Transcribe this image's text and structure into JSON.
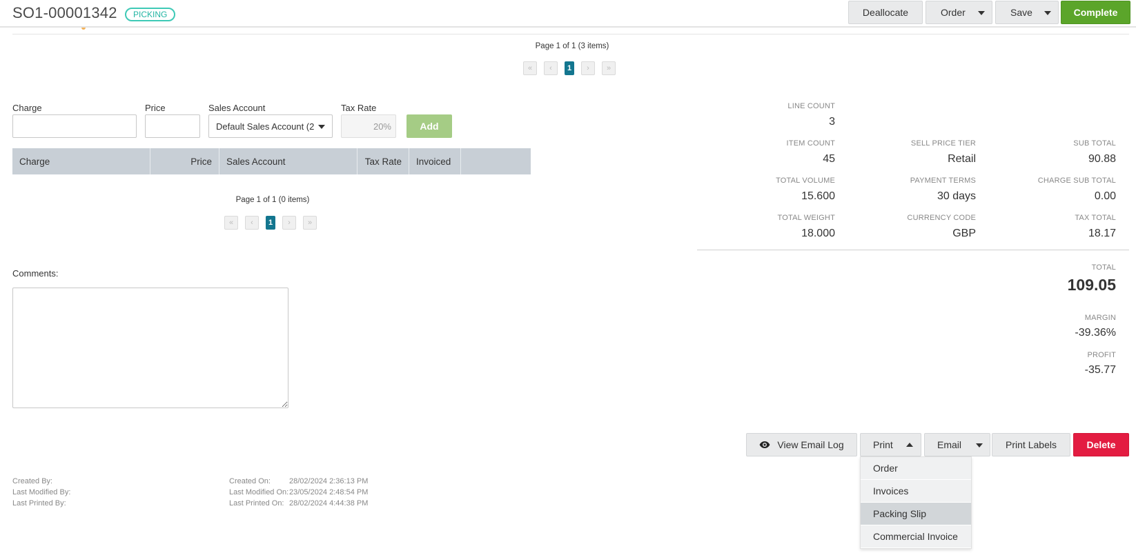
{
  "header": {
    "order_number": "SO1-00001342",
    "status": "PICKING",
    "buttons": {
      "deallocate": "Deallocate",
      "order": "Order",
      "save": "Save",
      "complete": "Complete"
    }
  },
  "lines_pager": {
    "text": "Page 1 of 1 (3 items)",
    "current": "1"
  },
  "charge_form": {
    "charge_label": "Charge",
    "charge_value": "",
    "price_label": "Price",
    "price_value": "",
    "sales_account_label": "Sales Account",
    "sales_account_selected": "Default Sales Account (2",
    "tax_rate_label": "Tax Rate",
    "tax_rate_value": "20%",
    "add_label": "Add"
  },
  "charges_table": {
    "columns": [
      "Charge",
      "Price",
      "Sales Account",
      "Tax Rate",
      "Invoiced",
      ""
    ],
    "rows": []
  },
  "charges_pager": {
    "text": "Page 1 of 1 (0 items)",
    "current": "1"
  },
  "comments": {
    "label": "Comments:",
    "value": ""
  },
  "summary": {
    "line_count": {
      "label": "LINE COUNT",
      "value": "3"
    },
    "item_count": {
      "label": "ITEM COUNT",
      "value": "45"
    },
    "sell_price_tier": {
      "label": "SELL PRICE TIER",
      "value": "Retail"
    },
    "sub_total": {
      "label": "SUB TOTAL",
      "value": "90.88"
    },
    "total_volume": {
      "label": "TOTAL VOLUME",
      "value": "15.600"
    },
    "payment_terms": {
      "label": "PAYMENT TERMS",
      "value": "30 days"
    },
    "charge_sub_total": {
      "label": "CHARGE SUB TOTAL",
      "value": "0.00"
    },
    "total_weight": {
      "label": "TOTAL WEIGHT",
      "value": "18.000"
    },
    "currency_code": {
      "label": "CURRENCY CODE",
      "value": "GBP"
    },
    "tax_total": {
      "label": "TAX TOTAL",
      "value": "18.17"
    },
    "total": {
      "label": "TOTAL",
      "value": "109.05"
    },
    "margin": {
      "label": "MARGIN",
      "value": "-39.36%"
    },
    "profit": {
      "label": "PROFIT",
      "value": "-35.77"
    }
  },
  "actions": {
    "view_email_log": "View Email Log",
    "print": "Print",
    "email": "Email",
    "print_labels": "Print Labels",
    "delete": "Delete"
  },
  "print_menu": {
    "items": [
      "Order",
      "Invoices",
      "Packing Slip",
      "Commercial Invoice"
    ],
    "highlighted": "Packing Slip"
  },
  "meta": {
    "created_by_label": "Created By:",
    "last_modified_by_label": "Last Modified By:",
    "last_printed_by_label": "Last Printed By:",
    "created_on_label": "Created On:",
    "created_on_value": "28/02/2024 2:36:13 PM",
    "last_modified_on_label": "Last Modified On:",
    "last_modified_on_value": "23/05/2024 2:48:54 PM",
    "last_printed_on_label": "Last Printed On:",
    "last_printed_on_value": "28/02/2024 4:44:38 PM"
  },
  "colors": {
    "complete_green": "#5ba52a",
    "delete_red": "#e31c41",
    "status_teal": "#3ec9b6",
    "pager_active": "#13768f",
    "add_green_disabled": "#a5cc85",
    "table_header": "#c8cfd6"
  },
  "icons": {
    "view_email_log": "eye-icon"
  }
}
